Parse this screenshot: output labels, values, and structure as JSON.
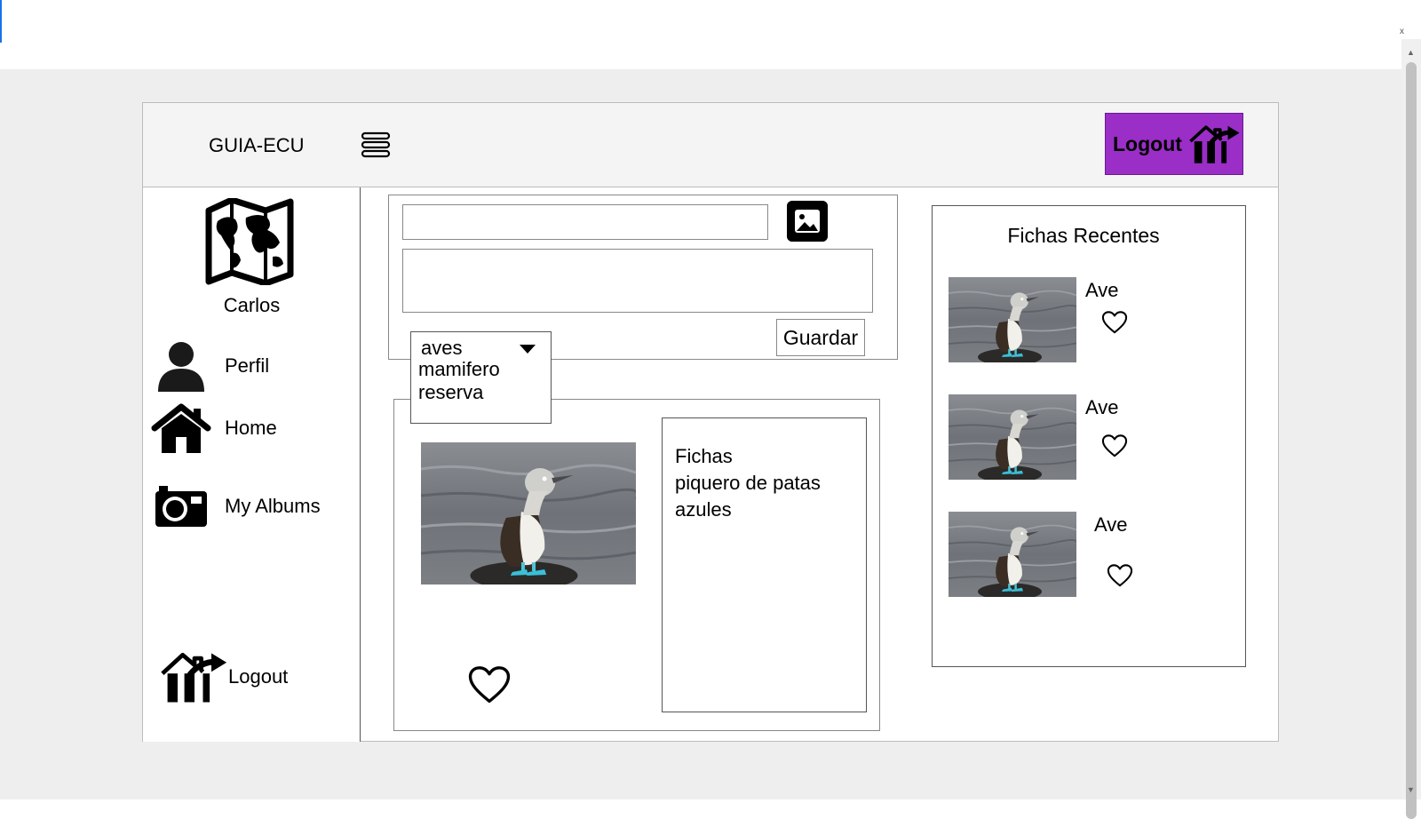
{
  "header": {
    "brand": "GUIA-ECU",
    "logout_label": "Logout"
  },
  "sidebar": {
    "user_name": "Carlos",
    "items": [
      {
        "label": "Perfil",
        "icon": "person-icon"
      },
      {
        "label": "Home",
        "icon": "home-icon"
      },
      {
        "label": "My Albums",
        "icon": "camera-icon"
      }
    ],
    "logout_label": "Logout"
  },
  "form": {
    "title_value": "",
    "description_value": "",
    "save_label": "Guardar",
    "category": {
      "selected": "aves",
      "options": [
        "mamifero",
        "reserva"
      ]
    }
  },
  "card": {
    "text_lines": [
      "Fichas",
      "piquero de patas azules"
    ]
  },
  "recent": {
    "title": "Fichas Recentes",
    "items": [
      {
        "label": "Ave"
      },
      {
        "label": "Ave"
      },
      {
        "label": "Ave"
      }
    ]
  },
  "colors": {
    "logout_bg": "#9a2ec7",
    "canvas_bg": "#eeeeee",
    "topbar_bg": "#f4f4f4"
  }
}
